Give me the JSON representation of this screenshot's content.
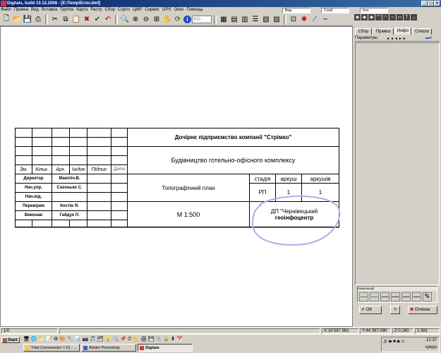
{
  "window": {
    "title": "Digitals, build 10.12.2008 - [E:\\Temp\\Error.dmf]"
  },
  "menu": [
    "Файл",
    "Правка",
    "Вид",
    "Вставка",
    "Группа",
    "Карта",
    "Растр",
    "Сбор",
    "Сорто",
    "ЦМР",
    "Сервис",
    "GPS",
    "Окно",
    "Помощь"
  ],
  "toolbar": {
    "zoom_value": "500",
    "dropdown_labels": [
      "Вид",
      "Слой",
      "Кол"
    ]
  },
  "right_panel": {
    "tabs": [
      "Сбор",
      "Правка",
      "Инфо",
      "Список"
    ],
    "active_tab": "Инфо",
    "params_label": "Параметры",
    "bottom_group_label": "Комунікації",
    "ok_label": "OK",
    "cancel_label": "Отмена"
  },
  "drawing": {
    "company": "Дочірнє підприємство компанії \"Стрімко\"",
    "project": "Будівництво готельно-офісного комплексу",
    "sheet_title": "Топографічний план",
    "scale": "М 1:500",
    "headers": [
      "Зм.",
      "Кільк.",
      "Арх.",
      "№док",
      "Підпис",
      "Дата"
    ],
    "stage_headers": [
      "стадія",
      "аркуш",
      "аркушів"
    ],
    "stage_values": [
      "РП",
      "1",
      "1"
    ],
    "org_line1": "ДП \"Чернівецький",
    "org_line2": "геоінфоцентр",
    "roles": [
      {
        "role": "Директор",
        "name": "Маніліч.В."
      },
      {
        "role": "Нач.упр.",
        "name": "Сахонько С."
      },
      {
        "role": "Нач.від.",
        "name": ""
      },
      {
        "role": "Перевірив",
        "name": "Костів Я."
      },
      {
        "role": "Виконав",
        "name": "Гайдук Л."
      }
    ]
  },
  "status": {
    "page": "1/0",
    "x": "X:19 587.981",
    "y": "Y:44 397.090",
    "z": "Z:0.260",
    "scale": "1:381"
  },
  "taskbar": {
    "start": "Start",
    "tasks": [
      "Total Commander 7.01 - ...",
      "Adobe Photoshop",
      "Digitals"
    ],
    "clock": "12:37",
    "day": "среда"
  },
  "colors": {
    "titlebar": "#0a246a",
    "annotation": "#b9a8e0"
  }
}
